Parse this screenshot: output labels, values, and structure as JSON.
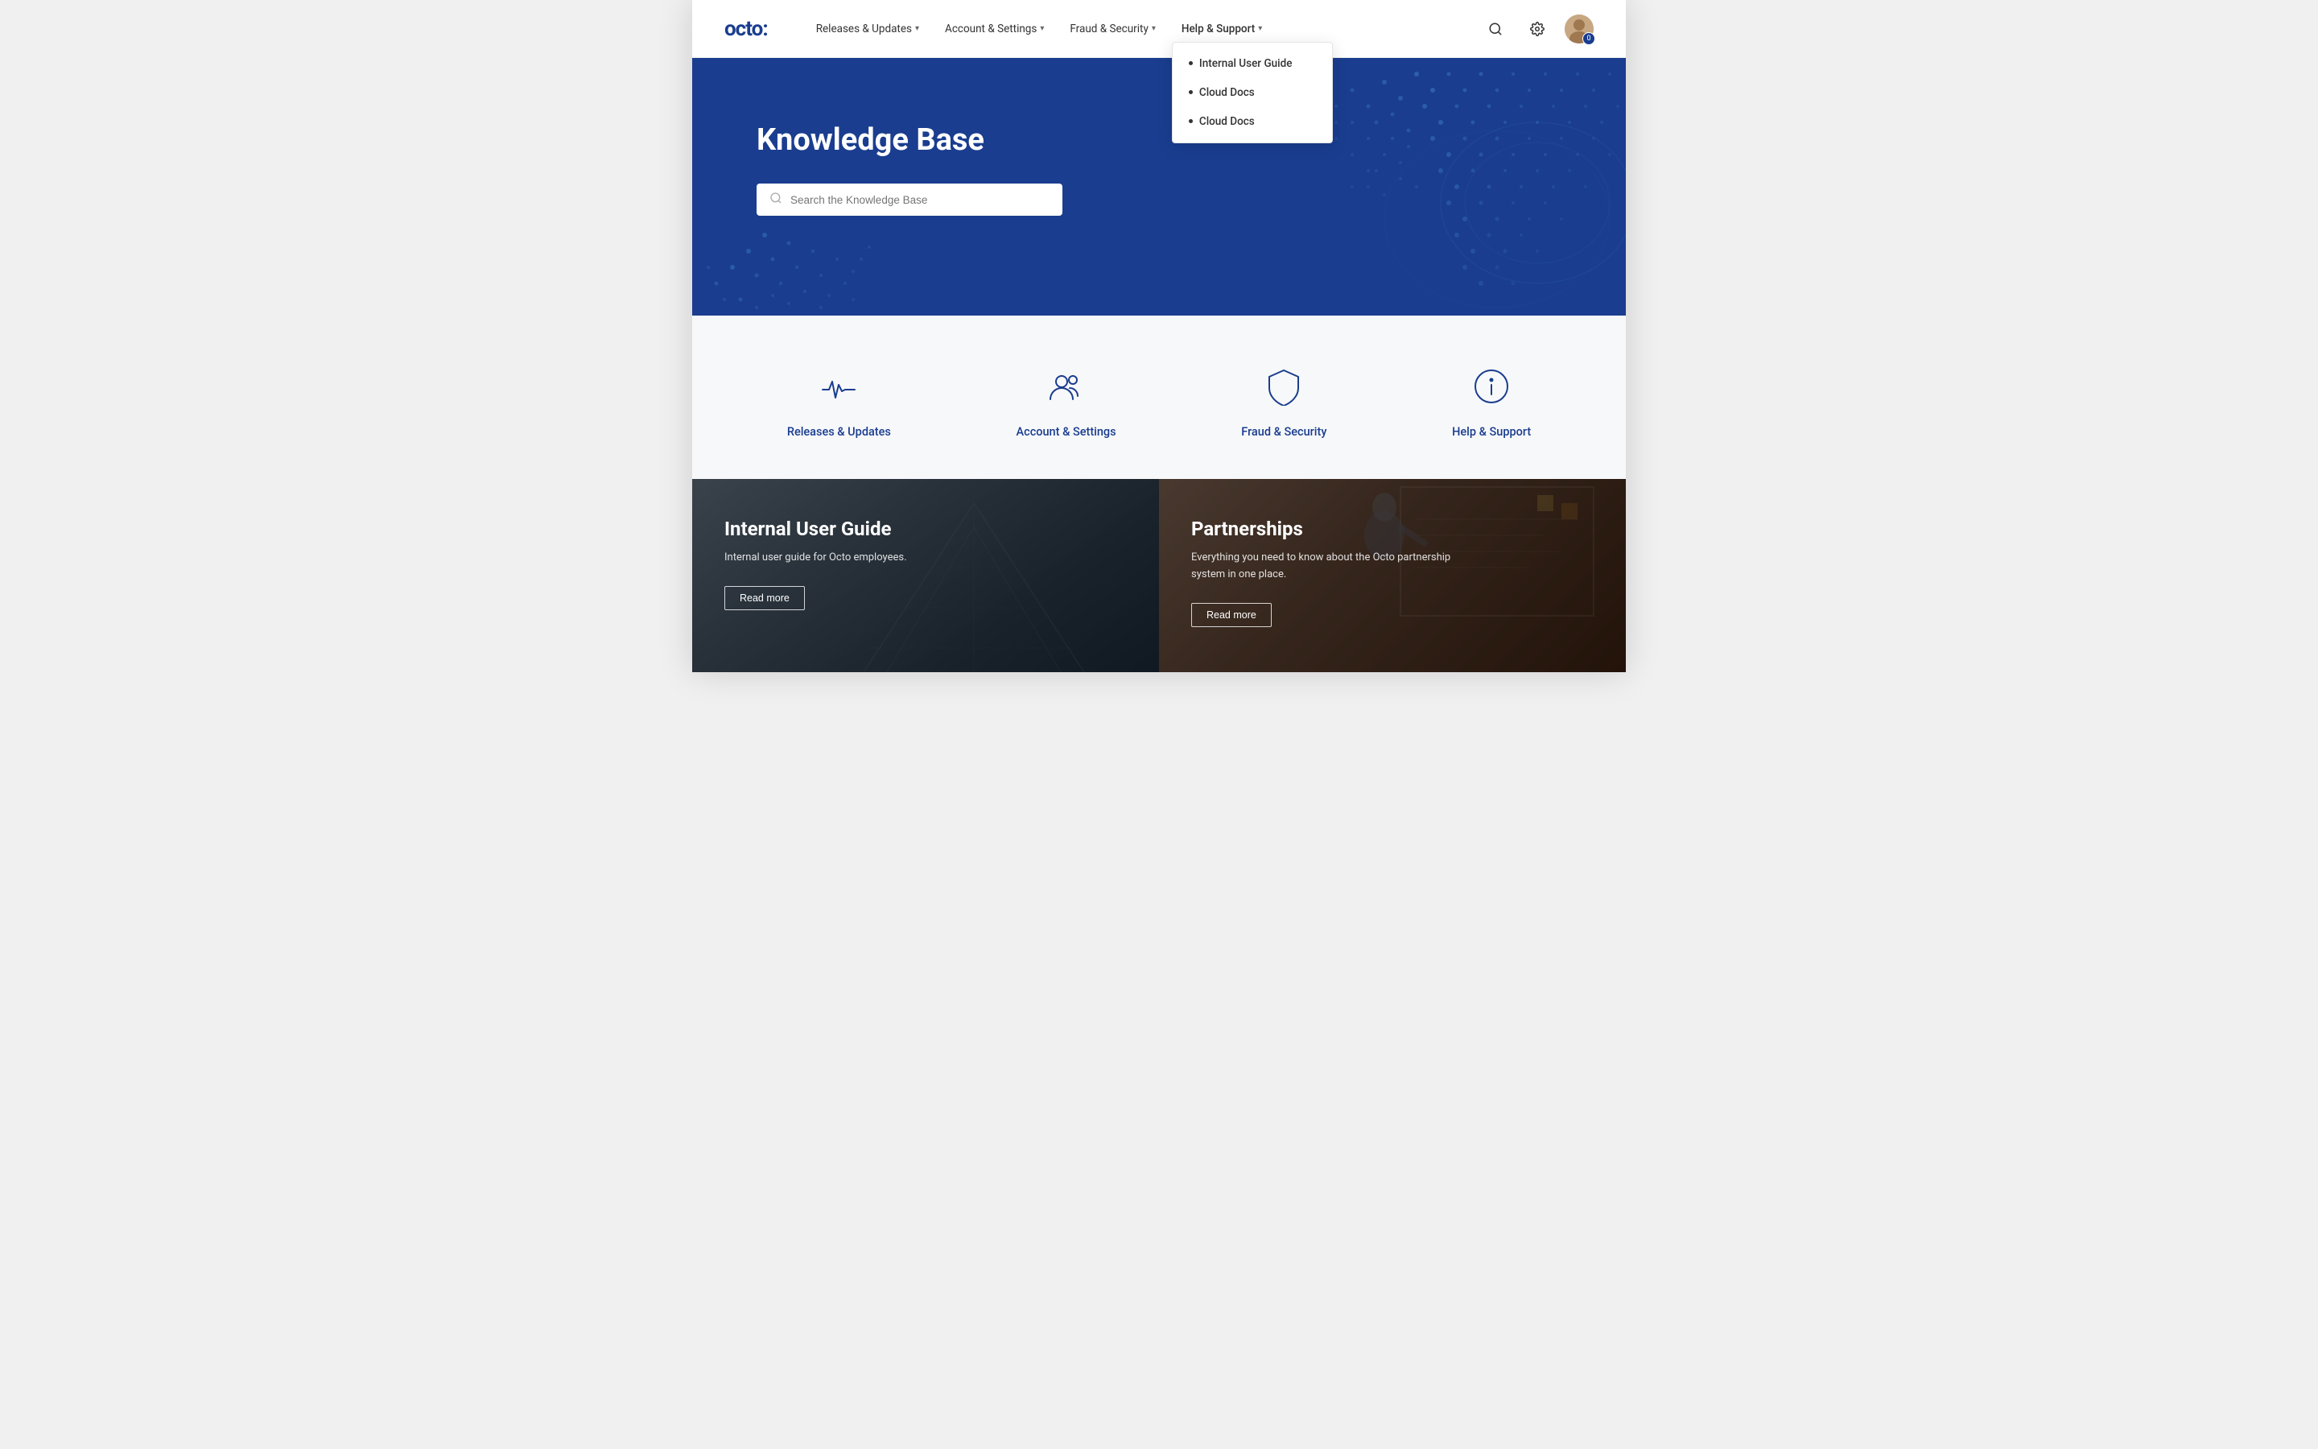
{
  "logo": {
    "text": "octo:"
  },
  "navbar": {
    "items": [
      {
        "label": "Releases & Updates",
        "has_dropdown": true
      },
      {
        "label": "Account & Settings",
        "has_dropdown": true
      },
      {
        "label": "Fraud & Security",
        "has_dropdown": true
      },
      {
        "label": "Help & Support",
        "has_dropdown": true,
        "is_open": true
      }
    ],
    "avatar_badge": "0"
  },
  "dropdown": {
    "items": [
      {
        "label": "Internal User Guide"
      },
      {
        "label": "Cloud Docs"
      },
      {
        "label": "Cloud Docs"
      }
    ]
  },
  "hero": {
    "title": "Knowledge Base",
    "search_placeholder": "Search the Knowledge Base"
  },
  "categories": [
    {
      "label": "Releases & Updates",
      "icon": "pulse-icon"
    },
    {
      "label": "Account & Settings",
      "icon": "users-icon"
    },
    {
      "label": "Fraud & Security",
      "icon": "shield-icon"
    },
    {
      "label": "Help & Support",
      "icon": "info-icon"
    }
  ],
  "cards": [
    {
      "title": "Internal User Guide",
      "desc": "Internal user guide for Octo employees.",
      "btn_label": "Read more"
    },
    {
      "title": "Partnerships",
      "desc": "Everything you need to know about the Octo partnership system in one place.",
      "btn_label": "Read more"
    }
  ]
}
